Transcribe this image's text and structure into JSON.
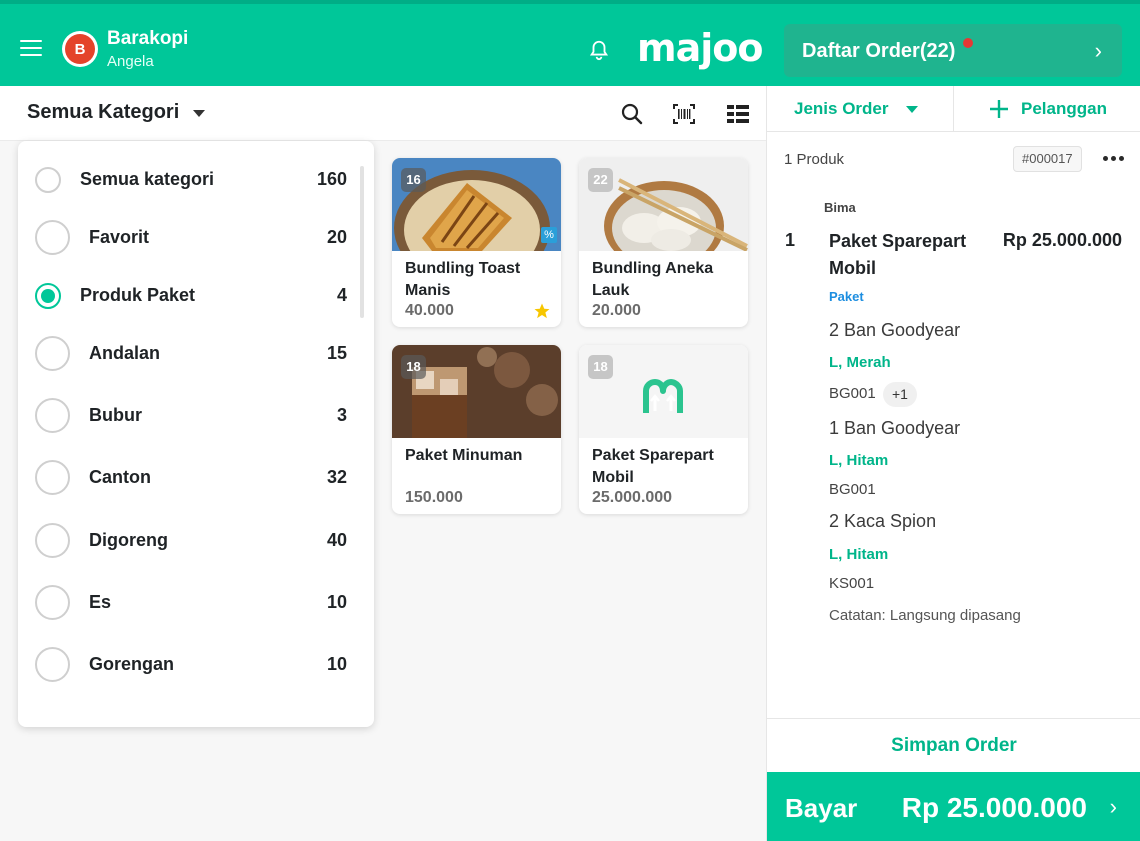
{
  "header": {
    "store_name": "Barakopi",
    "user_name": "Angela",
    "store_initial": "B",
    "brand": "majoo",
    "order_list_label": "Daftar Order(22)",
    "order_list_chevron": "›",
    "accent_color": "#00c799"
  },
  "toolbar": {
    "category_label": "Semua Kategori",
    "icons": [
      "search-icon",
      "barcode-icon",
      "grid-view-icon"
    ]
  },
  "categories": [
    {
      "name": "Semua kategori",
      "count": "160",
      "selected": false
    },
    {
      "name": "Favorit",
      "count": "20",
      "selected": false
    },
    {
      "name": "Produk Paket",
      "count": "4",
      "selected": true
    },
    {
      "name": "Andalan",
      "count": "15",
      "selected": false
    },
    {
      "name": "Bubur",
      "count": "3",
      "selected": false
    },
    {
      "name": "Canton",
      "count": "32",
      "selected": false
    },
    {
      "name": "Digoreng",
      "count": "40",
      "selected": false
    },
    {
      "name": "Es",
      "count": "10",
      "selected": false
    },
    {
      "name": "Gorengan",
      "count": "10",
      "selected": false
    }
  ],
  "products": [
    {
      "badge": "16",
      "name": "Bundling Toast Manis",
      "price": "40.000",
      "discount_icon": "%",
      "favorite": true
    },
    {
      "badge": "22",
      "name": "Bundling Aneka Lauk",
      "price": "20.000",
      "favorite": false
    },
    {
      "badge": "18",
      "name": "Paket Minuman",
      "price": "150.000",
      "favorite": false
    },
    {
      "badge": "18",
      "name": "Paket Sparepart Mobil",
      "price": "25.000.000",
      "favorite": false
    }
  ],
  "order": {
    "order_type_label": "Jenis Order",
    "customer_label": "Pelanggan",
    "product_count": "1 Produk",
    "order_id": "#000017",
    "staff": "Bima",
    "line_no": "1",
    "line_name": "Paket Sparepart Mobil",
    "line_price": "Rp 25.000.000",
    "tag": "Paket",
    "items": [
      {
        "name": "2 Ban Goodyear",
        "variant": "L, Merah",
        "sku": "BG001",
        "extra": "+1"
      },
      {
        "name": "1 Ban Goodyear",
        "variant": "L, Hitam",
        "sku": "BG001"
      },
      {
        "name": "2 Kaca Spion",
        "variant": "L, Hitam",
        "sku": "KS001"
      }
    ],
    "note": "Catatan: Langsung dipasang",
    "save_label": "Simpan Order",
    "pay_label": "Bayar",
    "pay_amount": "Rp 25.000.000",
    "pay_chevron": "›"
  }
}
